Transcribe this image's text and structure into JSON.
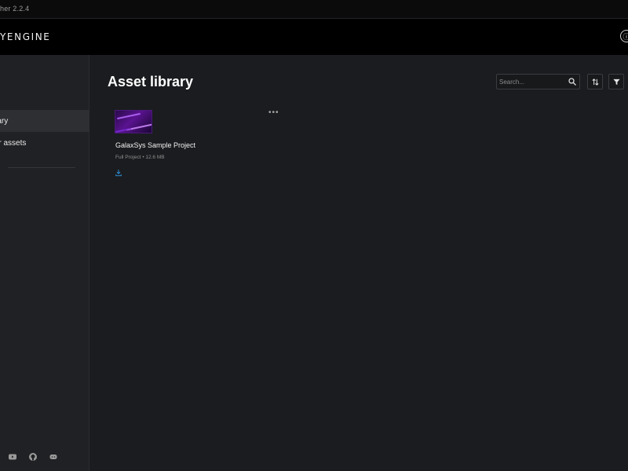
{
  "window": {
    "title": "her 2.2.4"
  },
  "header": {
    "brand": "YENGINE",
    "account_icon": "info-icon"
  },
  "sidebar": {
    "items": [
      {
        "label": "rary",
        "active": true
      },
      {
        "label": "tor assets",
        "active": false
      }
    ],
    "socials": [
      "youtube-icon",
      "github-icon",
      "discord-icon"
    ]
  },
  "main": {
    "title": "Asset library",
    "search": {
      "placeholder": "Search...",
      "value": ""
    },
    "toolbar": [
      "sort-icon",
      "filter-icon"
    ],
    "assets": [
      {
        "name": "GalaxSys Sample Project",
        "meta": "Full Project • 12.6 MB",
        "more_label": "•••",
        "action_icon": "download-icon"
      }
    ]
  },
  "colors": {
    "background": "#1b1c1f",
    "header": "#000000",
    "sidebar": "#202124",
    "accent": "#2b8fd6"
  }
}
